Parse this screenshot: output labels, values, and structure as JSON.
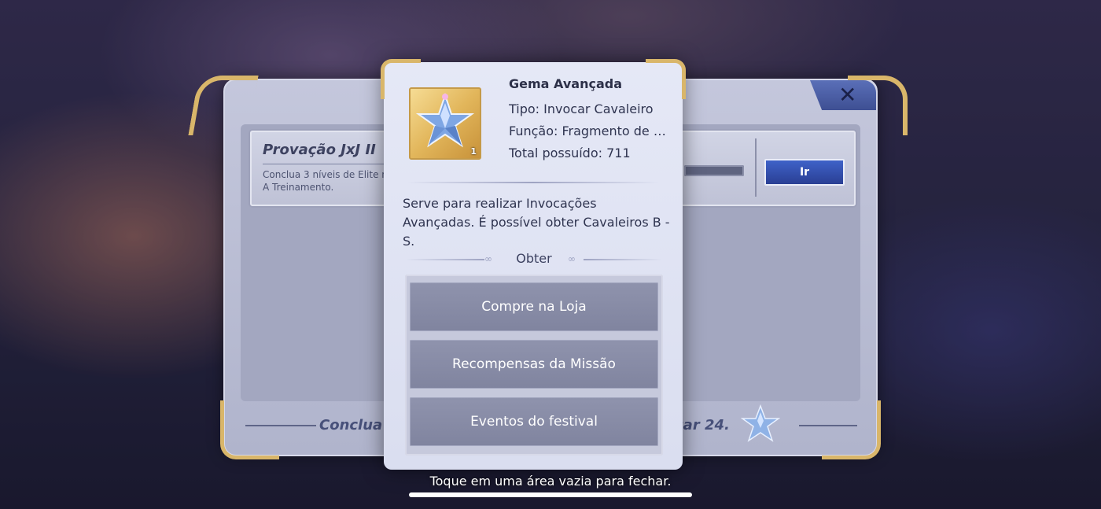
{
  "background_panel": {
    "mission": {
      "title": "Provação JxJ II",
      "description": "Conclua 3 níveis de Elite na A Treinamento.",
      "go_label": "Ir"
    },
    "footer_left": "Conclua to",
    "footer_right": "çar 24.",
    "close_icon": "✕"
  },
  "item": {
    "name": "Gema Avançada",
    "type": "Tipo: Invocar Cavaleiro",
    "function": "Função: Fragmento de Cav...",
    "owned": "Total possuído: 711",
    "count": "1",
    "icon": "crystal-star-icon",
    "description": "Serve para realizar Invocações Avançadas. É possível obter Cavaleiros B - S."
  },
  "obtain": {
    "label": "Obter",
    "sources": [
      "Compre na Loja",
      "Recompensas da Missão",
      "Eventos do festival"
    ]
  },
  "hint": "Toque em uma área vazia para fechar.",
  "colors": {
    "gold": "#d9b66a",
    "button_blue": "#3f62c8",
    "source_button": "#8f93ad"
  }
}
